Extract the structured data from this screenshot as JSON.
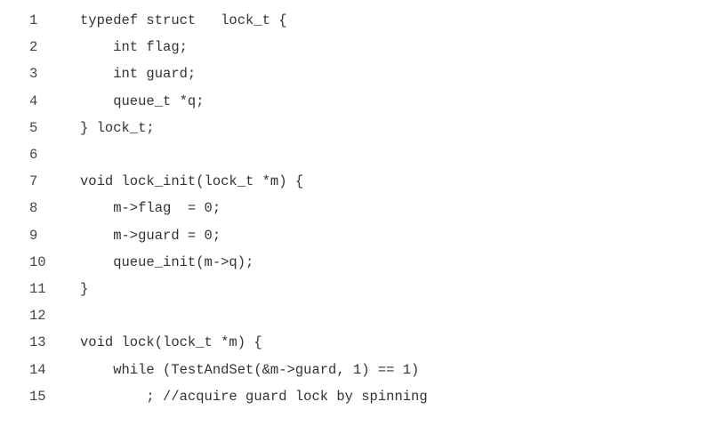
{
  "code": {
    "lines": [
      {
        "num": "1",
        "text": "typedef struct   lock_t {"
      },
      {
        "num": "2",
        "text": "    int flag;"
      },
      {
        "num": "3",
        "text": "    int guard;"
      },
      {
        "num": "4",
        "text": "    queue_t *q;"
      },
      {
        "num": "5",
        "text": "} lock_t;"
      },
      {
        "num": "6",
        "text": ""
      },
      {
        "num": "7",
        "text": "void lock_init(lock_t *m) {"
      },
      {
        "num": "8",
        "text": "    m->flag  = 0;"
      },
      {
        "num": "9",
        "text": "    m->guard = 0;"
      },
      {
        "num": "10",
        "text": "    queue_init(m->q);"
      },
      {
        "num": "11",
        "text": "}"
      },
      {
        "num": "12",
        "text": ""
      },
      {
        "num": "13",
        "text": "void lock(lock_t *m) {"
      },
      {
        "num": "14",
        "text": "    while (TestAndSet(&m->guard, 1) == 1)"
      },
      {
        "num": "15",
        "text": "        ; //acquire guard lock by spinning"
      }
    ]
  }
}
